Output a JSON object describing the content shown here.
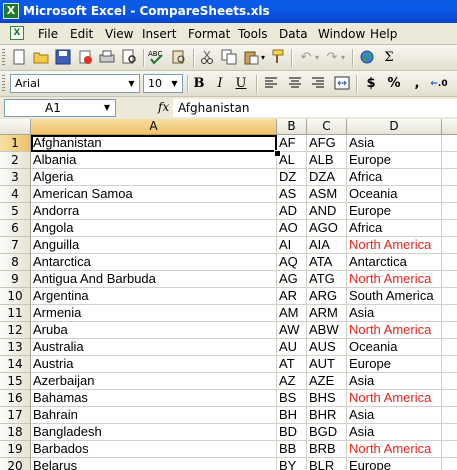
{
  "window": {
    "title": "Microsoft Excel - CompareSheets.xls",
    "app_icon": "X"
  },
  "menu": [
    "File",
    "Edit",
    "View",
    "Insert",
    "Format",
    "Tools",
    "Data",
    "Window",
    "Help"
  ],
  "doc_icon": "X",
  "toolbar": {
    "font_name": "Arial",
    "font_size": "10",
    "bold": "B",
    "italic": "I",
    "underline": "U",
    "currency": "$",
    "percent": "%",
    "comma": ",",
    "increase_decimal": ".0"
  },
  "formula_bar": {
    "name_box": "A1",
    "fx_label": "fx",
    "value": "Afghanistan"
  },
  "columns": [
    "A",
    "B",
    "C",
    "D"
  ],
  "rows": [
    {
      "n": "1",
      "a": "Afghanistan",
      "b": "AF",
      "c": "AFG",
      "d": "Asia",
      "red": false
    },
    {
      "n": "2",
      "a": "Albania",
      "b": "AL",
      "c": "ALB",
      "d": "Europe",
      "red": false
    },
    {
      "n": "3",
      "a": "Algeria",
      "b": "DZ",
      "c": "DZA",
      "d": "Africa",
      "red": false
    },
    {
      "n": "4",
      "a": "American Samoa",
      "b": "AS",
      "c": "ASM",
      "d": "Oceania",
      "red": false
    },
    {
      "n": "5",
      "a": "Andorra",
      "b": "AD",
      "c": "AND",
      "d": "Europe",
      "red": false
    },
    {
      "n": "6",
      "a": "Angola",
      "b": "AO",
      "c": "AGO",
      "d": "Africa",
      "red": false
    },
    {
      "n": "7",
      "a": "Anguilla",
      "b": "AI",
      "c": "AIA",
      "d": "North America",
      "red": true
    },
    {
      "n": "8",
      "a": "Antarctica",
      "b": "AQ",
      "c": "ATA",
      "d": "Antarctica",
      "red": false
    },
    {
      "n": "9",
      "a": "Antigua And Barbuda",
      "b": "AG",
      "c": "ATG",
      "d": "North America",
      "red": true
    },
    {
      "n": "10",
      "a": "Argentina",
      "b": "AR",
      "c": "ARG",
      "d": "South America",
      "red": false
    },
    {
      "n": "11",
      "a": "Armenia",
      "b": "AM",
      "c": "ARM",
      "d": "Asia",
      "red": false
    },
    {
      "n": "12",
      "a": "Aruba",
      "b": "AW",
      "c": "ABW",
      "d": "North America",
      "red": true
    },
    {
      "n": "13",
      "a": "Australia",
      "b": "AU",
      "c": "AUS",
      "d": "Oceania",
      "red": false
    },
    {
      "n": "14",
      "a": "Austria",
      "b": "AT",
      "c": "AUT",
      "d": "Europe",
      "red": false
    },
    {
      "n": "15",
      "a": "Azerbaijan",
      "b": "AZ",
      "c": "AZE",
      "d": "Asia",
      "red": false
    },
    {
      "n": "16",
      "a": "Bahamas",
      "b": "BS",
      "c": "BHS",
      "d": "North America",
      "red": true
    },
    {
      "n": "17",
      "a": "Bahrain",
      "b": "BH",
      "c": "BHR",
      "d": "Asia",
      "red": false
    },
    {
      "n": "18",
      "a": "Bangladesh",
      "b": "BD",
      "c": "BGD",
      "d": "Asia",
      "red": false
    },
    {
      "n": "19",
      "a": "Barbados",
      "b": "BB",
      "c": "BRB",
      "d": "North America",
      "red": true
    },
    {
      "n": "20",
      "a": "Belarus",
      "b": "BY",
      "c": "BLR",
      "d": "Europe",
      "red": false
    }
  ],
  "colors": {
    "highlight_text": "#e8251c",
    "title_bar": "#0a5ae6"
  }
}
